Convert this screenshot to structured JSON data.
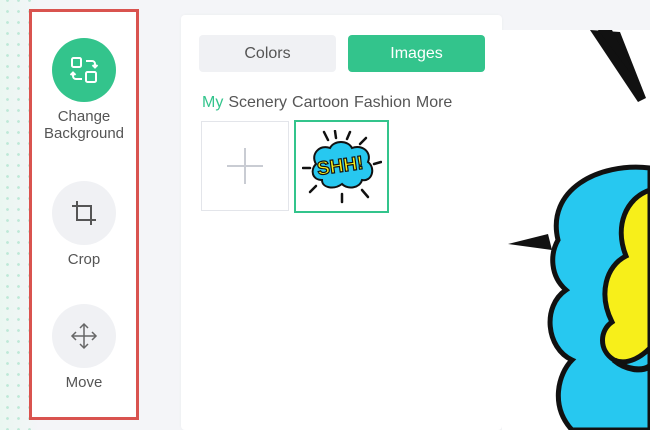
{
  "tools": {
    "change_background": {
      "label_line1": "Change",
      "label_line2": "Background",
      "icon": "change-background-icon",
      "active": true
    },
    "crop": {
      "label": "Crop",
      "icon": "crop-icon"
    },
    "move": {
      "label": "Move",
      "icon": "move-icon"
    }
  },
  "panel": {
    "tabs": [
      {
        "label": "Colors",
        "selected": false
      },
      {
        "label": "Images",
        "selected": true
      }
    ],
    "categories": [
      "My",
      "Scenery",
      "Cartoon",
      "Fashion",
      "More"
    ],
    "active_category": "My",
    "image_text": "SHH!"
  },
  "colors": {
    "accent": "#33c48c",
    "highlight_border": "#d9534f",
    "bubble_cyan": "#27c8f0",
    "bubble_yellow": "#f7ef1a"
  }
}
